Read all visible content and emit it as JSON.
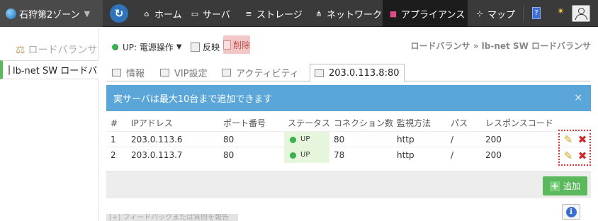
{
  "topnav": {
    "zone": "石狩第2ゾーン",
    "items": [
      {
        "label": "ホーム",
        "icon": "home-icon"
      },
      {
        "label": "サーバ",
        "icon": "server-icon"
      },
      {
        "label": "ストレージ",
        "icon": "storage-icon"
      },
      {
        "label": "ネットワーク",
        "icon": "network-icon"
      },
      {
        "label": "アプライアンス",
        "icon": "appliance-icon"
      },
      {
        "label": "マップ",
        "icon": "map-icon"
      }
    ],
    "info_glyph": "?",
    "star_glyph": "✴"
  },
  "sidebar": {
    "heading": "ロードバランサ",
    "item": "lb-net SW ロードバランサ"
  },
  "toolbar": {
    "status": "UP: 電源操作",
    "reflect": "反映",
    "delete": "削除"
  },
  "breadcrumb": "ロードバランサ » lb-net SW ロードバランサ",
  "tabs": [
    {
      "label": "情報"
    },
    {
      "label": "VIP設定"
    },
    {
      "label": "アクティビティ"
    },
    {
      "label": "203.0.113.8:80"
    }
  ],
  "alert": {
    "message": "実サーバは最大10台まで追加できます",
    "close": "×"
  },
  "table": {
    "headers": [
      "#",
      "IPアドレス",
      "ポート番号",
      "ステータス",
      "コネクション数",
      "監視方法",
      "パス",
      "レスポンスコード"
    ],
    "rows": [
      {
        "num": "1",
        "ip": "203.0.113.6",
        "port": "80",
        "status": "UP",
        "conn": "80",
        "method": "http",
        "path": "/",
        "code": "200"
      },
      {
        "num": "2",
        "ip": "203.0.113.7",
        "port": "80",
        "status": "UP",
        "conn": "78",
        "method": "http",
        "path": "/",
        "code": "200"
      }
    ]
  },
  "add_button": "追加",
  "info_glyph": "i",
  "feedback": "[+] フィードバックまたは質問を報告",
  "colors": {
    "accent": "#5cb85c",
    "alert": "#5aa6d8",
    "status_up": "#37b24d"
  }
}
